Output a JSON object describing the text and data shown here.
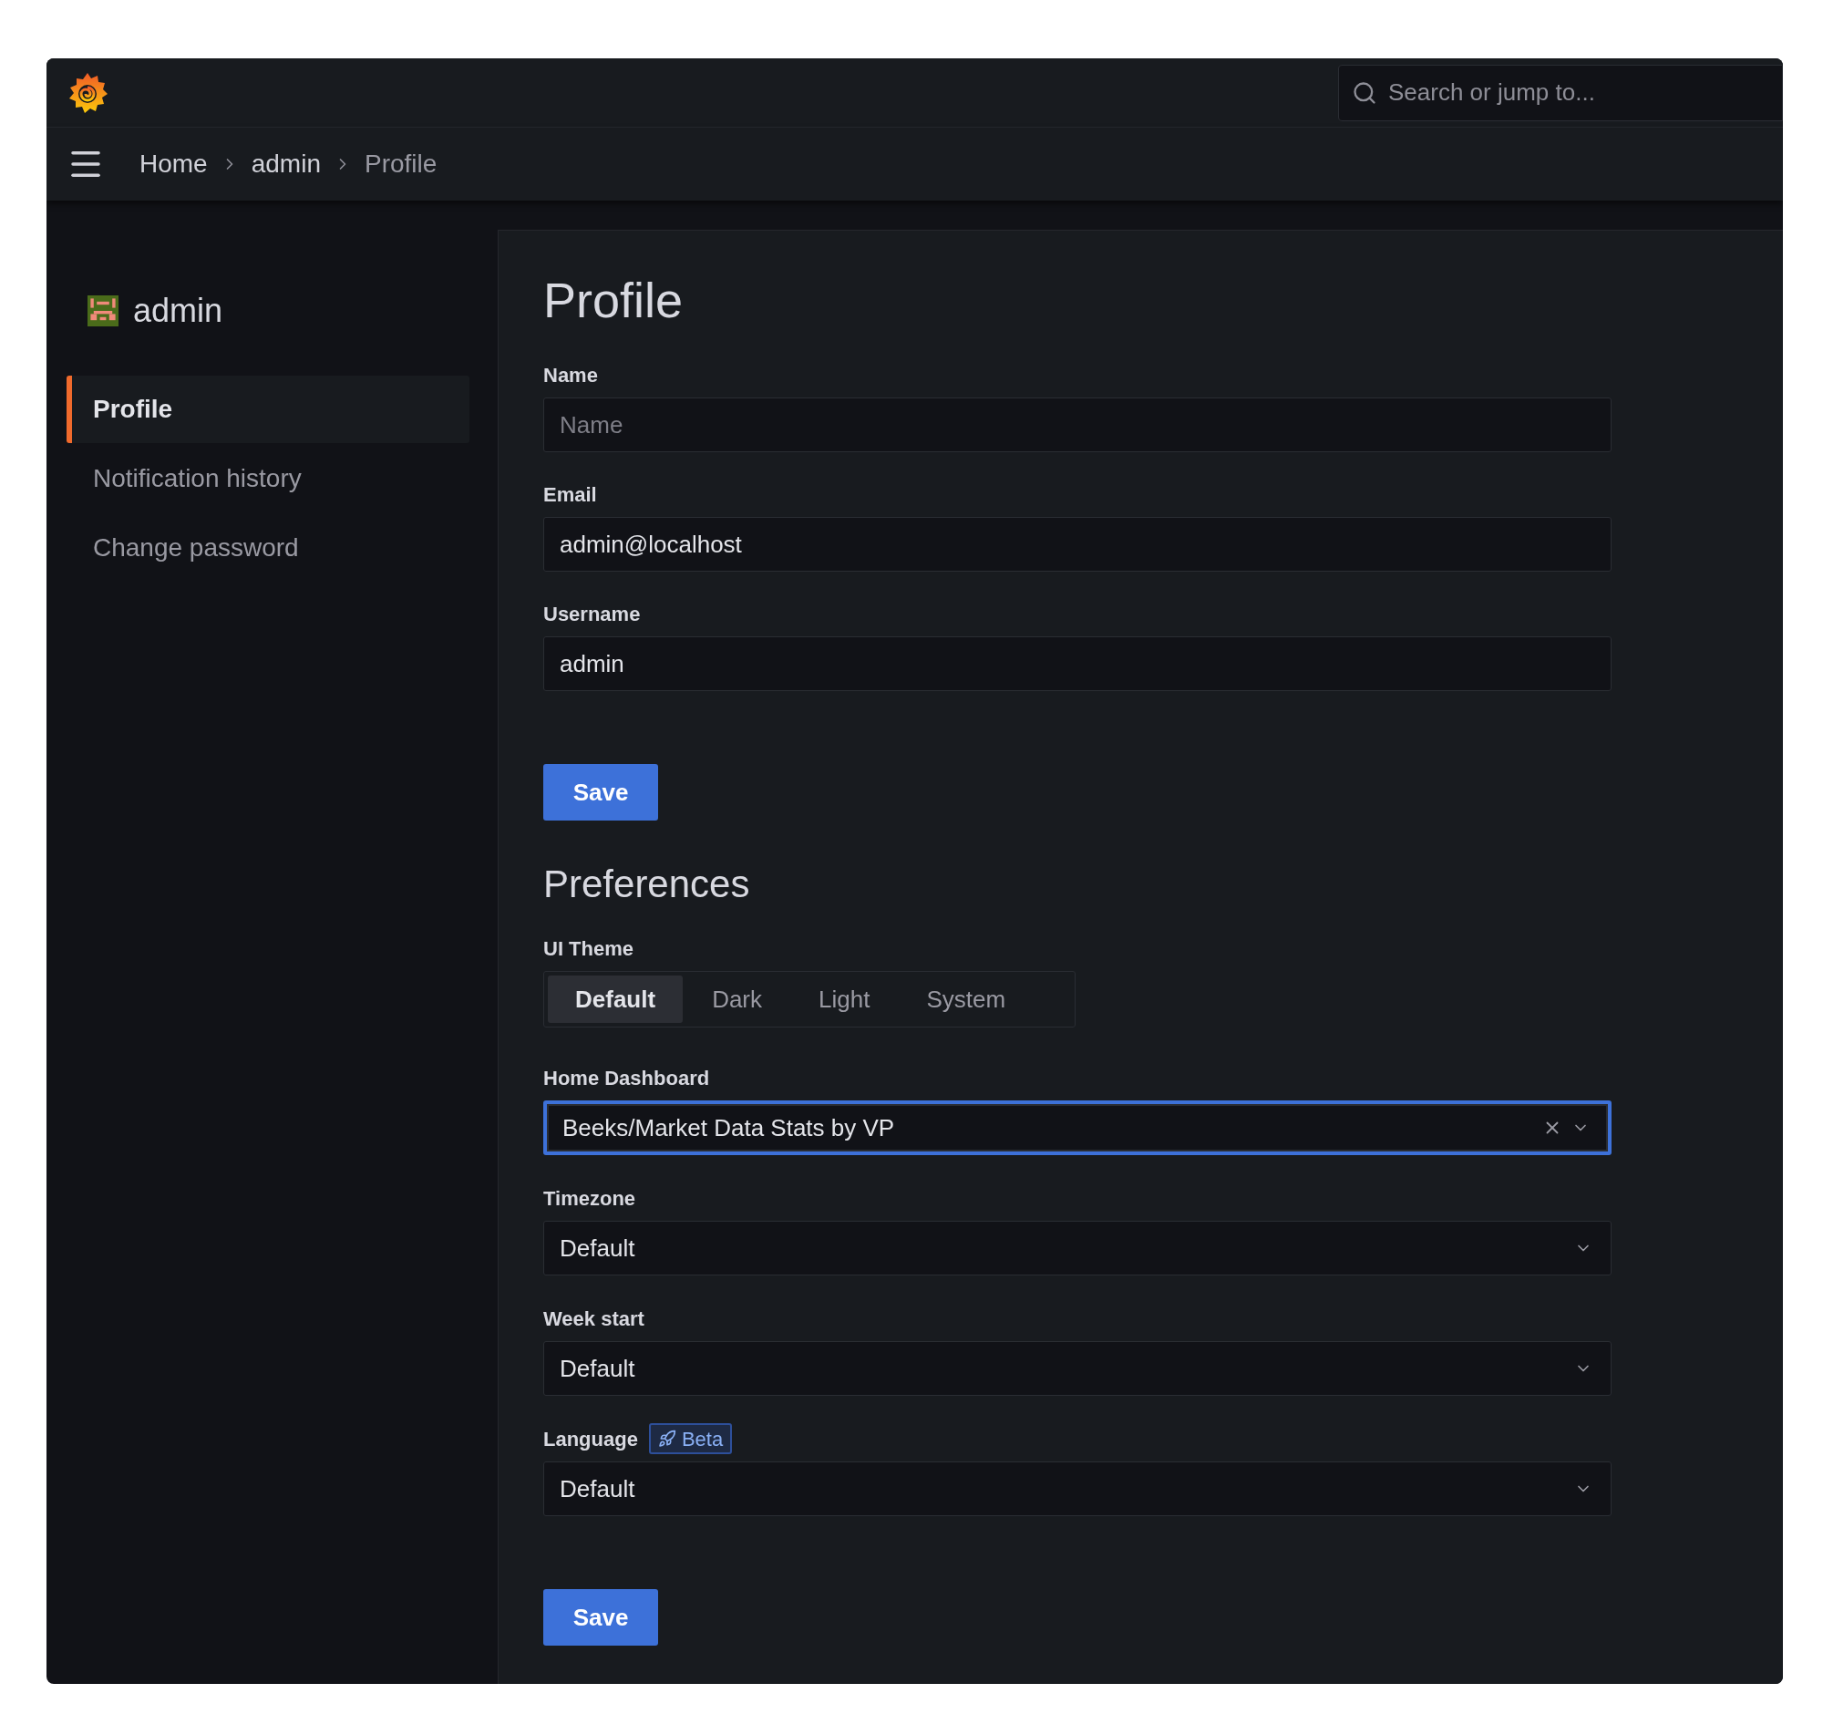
{
  "top_bar": {
    "search": {
      "placeholder": "Search or jump to..."
    }
  },
  "breadcrumb": [
    {
      "label": "Home",
      "current": false
    },
    {
      "label": "admin",
      "current": false
    },
    {
      "label": "Profile",
      "current": true
    }
  ],
  "sidebar": {
    "user": "admin",
    "items": [
      {
        "label": "Profile",
        "selected": true
      },
      {
        "label": "Notification history",
        "selected": false
      },
      {
        "label": "Change password",
        "selected": false
      }
    ]
  },
  "profile": {
    "title": "Profile",
    "fields": [
      {
        "label": "Name",
        "placeholder": "Name"
      },
      {
        "label": "Email",
        "value": "admin@localhost"
      },
      {
        "label": "Username",
        "value": "admin"
      }
    ],
    "save_button": "Save"
  },
  "preferences": {
    "title": "Preferences",
    "ui_theme": {
      "label": "UI Theme",
      "options": [
        {
          "label": "Default",
          "selected": true
        },
        {
          "label": "Dark",
          "selected": false
        },
        {
          "label": "Light",
          "selected": false
        },
        {
          "label": "System",
          "selected": false
        }
      ]
    },
    "selects": [
      {
        "label": "Home Dashboard",
        "value": "Beeks/Market Data Stats by VP",
        "focused": true,
        "clearable": true
      },
      {
        "label": "Timezone",
        "value": "Default",
        "focused": false,
        "clearable": false
      },
      {
        "label": "Week start",
        "value": "Default",
        "focused": false,
        "clearable": false
      },
      {
        "label": "Language",
        "badge": "Beta",
        "value": "Default",
        "focused": false,
        "clearable": false
      }
    ],
    "save_button": "Save"
  }
}
